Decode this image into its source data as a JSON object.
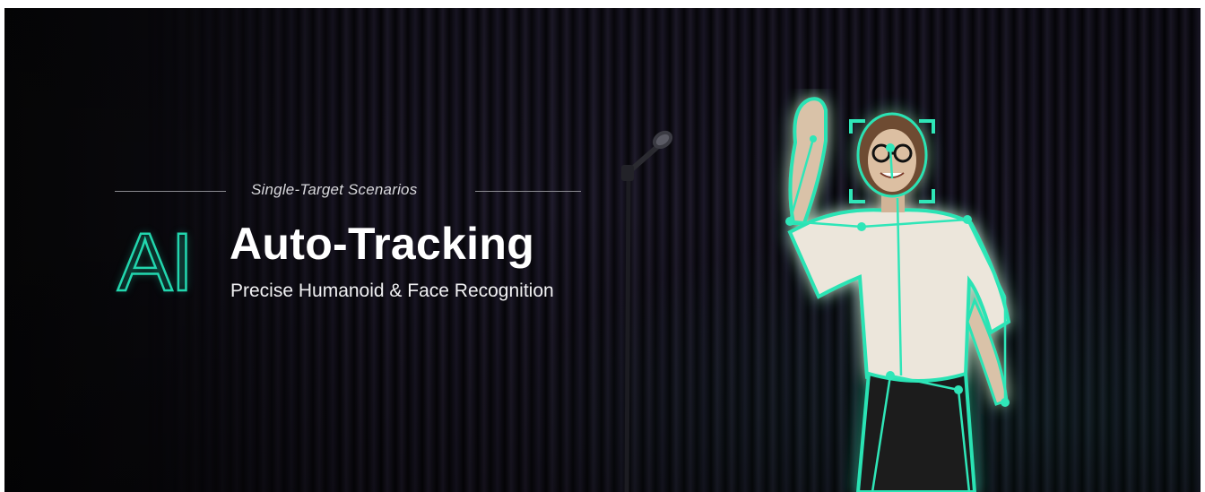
{
  "banner": {
    "subtitle": "Single-Target Scenarios",
    "ai_mark": "AI",
    "headline": "Auto-Tracking",
    "tagline": "Precise Humanoid & Face Recognition"
  },
  "colors": {
    "accent": "#22d6ae",
    "background": "#0b0a10",
    "text": "#ffffff"
  },
  "icons": [
    "microphone-icon",
    "face-frame-icon",
    "skeleton-overlay-icon"
  ]
}
